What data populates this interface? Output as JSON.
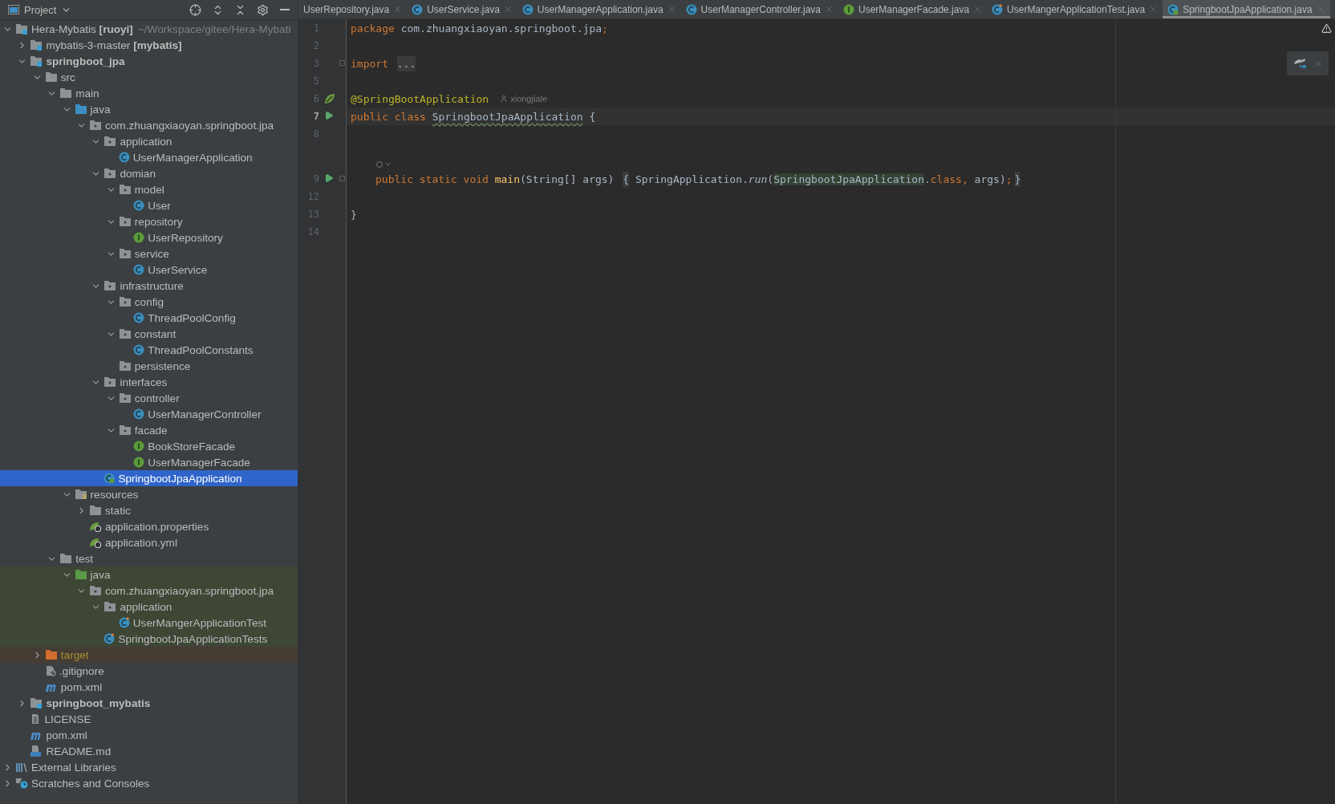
{
  "project_view": {
    "title": "Project",
    "tree": [
      {
        "label": "Hera-Mybatis **[ruoyi]**",
        "hint": "~/Workspace/gitee/Hera-Mybati",
        "kind": "module",
        "selected": false,
        "expanded": true,
        "children": [
          {
            "label": "mybatis-3-master **[mybatis]**",
            "kind": "module",
            "selected": false,
            "expanded": false
          },
          {
            "label": "springboot_jpa",
            "kind": "module",
            "bold": true,
            "selected": false,
            "expanded": true,
            "children": [
              {
                "label": "src",
                "kind": "folder",
                "selected": false,
                "expanded": true,
                "children": [
                  {
                    "label": "main",
                    "kind": "folder",
                    "selected": false,
                    "expanded": true,
                    "children": [
                      {
                        "label": "java",
                        "kind": "source-folder",
                        "selected": false,
                        "expanded": true,
                        "children": [
                          {
                            "label": "com.zhuangxiaoyan.springboot.jpa",
                            "kind": "package",
                            "selected": false,
                            "expanded": true,
                            "children": [
                              {
                                "label": "application",
                                "kind": "package",
                                "selected": false,
                                "expanded": true,
                                "children": [
                                  {
                                    "label": "UserManagerApplication",
                                    "kind": "class",
                                    "selected": false
                                  }
                                ]
                              },
                              {
                                "label": "domian",
                                "kind": "package",
                                "selected": false,
                                "expanded": true,
                                "children": [
                                  {
                                    "label": "model",
                                    "kind": "package",
                                    "selected": false,
                                    "expanded": true,
                                    "children": [
                                      {
                                        "label": "User",
                                        "kind": "class",
                                        "selected": false
                                      }
                                    ]
                                  },
                                  {
                                    "label": "repository",
                                    "kind": "package",
                                    "selected": false,
                                    "expanded": true,
                                    "children": [
                                      {
                                        "label": "UserRepository",
                                        "kind": "interface",
                                        "selected": false
                                      }
                                    ]
                                  },
                                  {
                                    "label": "service",
                                    "kind": "package",
                                    "selected": false,
                                    "expanded": true,
                                    "children": [
                                      {
                                        "label": "UserService",
                                        "kind": "class",
                                        "selected": false
                                      }
                                    ]
                                  }
                                ]
                              },
                              {
                                "label": "infrastructure",
                                "kind": "package",
                                "selected": false,
                                "expanded": true,
                                "children": [
                                  {
                                    "label": "config",
                                    "kind": "package",
                                    "selected": false,
                                    "expanded": true,
                                    "children": [
                                      {
                                        "label": "ThreadPoolConfig",
                                        "kind": "class",
                                        "selected": false
                                      }
                                    ]
                                  },
                                  {
                                    "label": "constant",
                                    "kind": "package",
                                    "selected": false,
                                    "expanded": true,
                                    "children": [
                                      {
                                        "label": "ThreadPoolConstants",
                                        "kind": "class",
                                        "selected": false
                                      }
                                    ]
                                  },
                                  {
                                    "label": "persistence",
                                    "kind": "package",
                                    "selected": false
                                  }
                                ]
                              },
                              {
                                "label": "interfaces",
                                "kind": "package",
                                "selected": false,
                                "expanded": true,
                                "children": [
                                  {
                                    "label": "controller",
                                    "kind": "package",
                                    "selected": false,
                                    "expanded": true,
                                    "children": [
                                      {
                                        "label": "UserManagerController",
                                        "kind": "class",
                                        "selected": false
                                      }
                                    ]
                                  },
                                  {
                                    "label": "facade",
                                    "kind": "package",
                                    "selected": false,
                                    "expanded": true,
                                    "children": [
                                      {
                                        "label": "BookStoreFacade",
                                        "kind": "interface",
                                        "selected": false
                                      },
                                      {
                                        "label": "UserManagerFacade",
                                        "kind": "interface",
                                        "selected": false
                                      }
                                    ]
                                  }
                                ]
                              },
                              {
                                "label": "SpringbootJpaApplication",
                                "kind": "spring-class",
                                "selected": true
                              }
                            ]
                          }
                        ]
                      },
                      {
                        "label": "resources",
                        "kind": "resource-folder",
                        "selected": false,
                        "expanded": true,
                        "children": [
                          {
                            "label": "static",
                            "kind": "folder",
                            "selected": false,
                            "expanded": false
                          },
                          {
                            "label": "application.properties",
                            "kind": "spring-config",
                            "selected": false
                          },
                          {
                            "label": "application.yml",
                            "kind": "spring-config",
                            "selected": false
                          }
                        ]
                      }
                    ]
                  },
                  {
                    "label": "test",
                    "kind": "folder",
                    "selected": false,
                    "expanded": true,
                    "children": [
                      {
                        "label": "java",
                        "kind": "test-folder",
                        "selected": false,
                        "expanded": true,
                        "children": [
                          {
                            "label": "com.zhuangxiaoyan.springboot.jpa",
                            "kind": "package",
                            "selected": false,
                            "expanded": true,
                            "children": [
                              {
                                "label": "application",
                                "kind": "package",
                                "selected": false,
                                "expanded": true,
                                "children": [
                                  {
                                    "label": "UserMangerApplicationTest",
                                    "kind": "test-class",
                                    "selected": false
                                  }
                                ]
                              },
                              {
                                "label": "SpringbootJpaApplicationTests",
                                "kind": "test-class",
                                "selected": false
                              }
                            ]
                          }
                        ]
                      }
                    ]
                  }
                ]
              },
              {
                "label": "target",
                "kind": "excluded-folder",
                "selected": false,
                "expanded": false
              },
              {
                "label": ".gitignore",
                "kind": "ignore-file",
                "selected": false
              },
              {
                "label": "pom.xml",
                "kind": "maven",
                "selected": false
              }
            ]
          },
          {
            "label": "springboot_mybatis",
            "kind": "module",
            "bold": true,
            "selected": false,
            "expanded": false
          },
          {
            "label": "LICENSE",
            "kind": "text-file",
            "selected": false
          },
          {
            "label": "pom.xml",
            "kind": "maven",
            "selected": false
          },
          {
            "label": "README.md",
            "kind": "markdown",
            "selected": false
          }
        ]
      },
      {
        "label": "External Libraries",
        "kind": "libraries",
        "selected": false,
        "expanded": false
      },
      {
        "label": "Scratches and Consoles",
        "kind": "scratches",
        "selected": false,
        "expanded": false
      }
    ]
  },
  "tabs": [
    {
      "label": "UserRepository.java",
      "kind": "none",
      "selected": false
    },
    {
      "label": "UserService.java",
      "kind": "class",
      "selected": false
    },
    {
      "label": "UserManagerApplication.java",
      "kind": "class",
      "selected": false
    },
    {
      "label": "UserManagerController.java",
      "kind": "class",
      "selected": false
    },
    {
      "label": "UserManagerFacade.java",
      "kind": "interface",
      "selected": false
    },
    {
      "label": "UserMangerApplicationTest.java",
      "kind": "test-class",
      "selected": false
    },
    {
      "label": "SpringbootJpaApplication.java",
      "kind": "spring-class",
      "selected": true
    }
  ],
  "editor": {
    "lines": [
      {
        "number": "1",
        "current": false,
        "tokens": [
          {
            "kind": "keyword",
            "text": "package "
          },
          {
            "kind": "plain",
            "text": "com.zhuangxiaoyan.springboot.jpa"
          },
          {
            "kind": "keyword",
            "text": ";"
          }
        ]
      },
      {
        "number": "2",
        "current": false
      },
      {
        "number": "3",
        "current": false,
        "fold": true,
        "tokens": [
          {
            "kind": "keyword",
            "text": "import "
          },
          {
            "kind": "folded",
            "text": "..."
          }
        ]
      },
      {
        "number": "5",
        "current": false
      },
      {
        "number": "6",
        "current": false,
        "spring_bean": true,
        "author": "xiongjiale",
        "tokens": [
          {
            "kind": "annotation",
            "text": "@SpringBootApplication"
          }
        ]
      },
      {
        "number": "7",
        "current": true,
        "runnable": true,
        "tokens": [
          {
            "kind": "keyword",
            "text": "public class "
          },
          {
            "kind": "declaration",
            "text": "SpringbootJpaApplication"
          },
          {
            "kind": "plain",
            "text": " {"
          }
        ]
      },
      {
        "number": "8",
        "current": false
      },
      {
        "number": "9",
        "current": false,
        "runnable": true,
        "fold": true,
        "inlay": true,
        "indented": true,
        "tokens": [
          {
            "kind": "keyword",
            "text": "public static void "
          },
          {
            "kind": "method",
            "text": "main"
          },
          {
            "kind": "plain",
            "text": "(String[] args) "
          },
          {
            "kind": "folded",
            "text": "{"
          },
          {
            "kind": "plain",
            "text": " SpringApplication."
          },
          {
            "kind": "static-call",
            "text": "run"
          },
          {
            "kind": "plain",
            "text": "("
          },
          {
            "kind": "usage",
            "text": "SpringbootJpaApplication"
          },
          {
            "kind": "plain",
            "text": "."
          },
          {
            "kind": "keyword",
            "text": "class, "
          },
          {
            "kind": "plain",
            "text": "args)"
          },
          {
            "kind": "keyword",
            "text": ";"
          },
          {
            "kind": "folded",
            "text": "}"
          }
        ]
      },
      {
        "number": "12",
        "current": false
      },
      {
        "number": "13",
        "current": false,
        "tokens": [
          {
            "kind": "plain",
            "text": "}"
          }
        ]
      },
      {
        "number": "14",
        "current": false
      }
    ]
  }
}
